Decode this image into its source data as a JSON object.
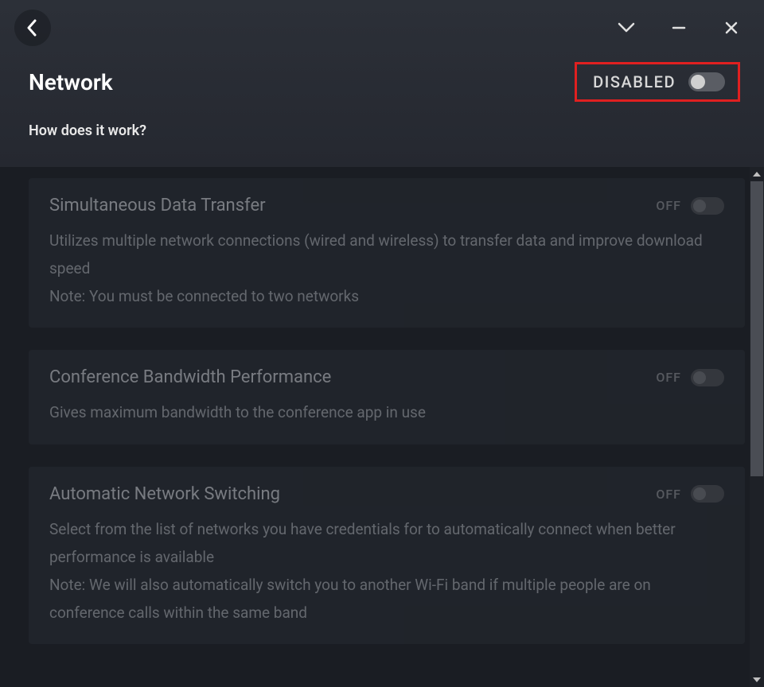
{
  "header": {
    "title": "Network",
    "master_toggle_label": "DISABLED",
    "help_link": "How does it work?"
  },
  "cards": [
    {
      "title": "Simultaneous Data Transfer",
      "toggle_label": "OFF",
      "desc": "Utilizes multiple network connections (wired and wireless) to transfer data and improve download speed\nNote: You must be connected to two networks"
    },
    {
      "title": "Conference Bandwidth Performance",
      "toggle_label": "OFF",
      "desc": "Gives maximum bandwidth to the conference app in use"
    },
    {
      "title": "Automatic Network Switching",
      "toggle_label": "OFF",
      "desc": "Select from the list of networks you have credentials for to automatically connect when better performance is available\nNote: We will also automatically switch you to another Wi-Fi band if multiple people are on conference calls within the same band"
    }
  ]
}
